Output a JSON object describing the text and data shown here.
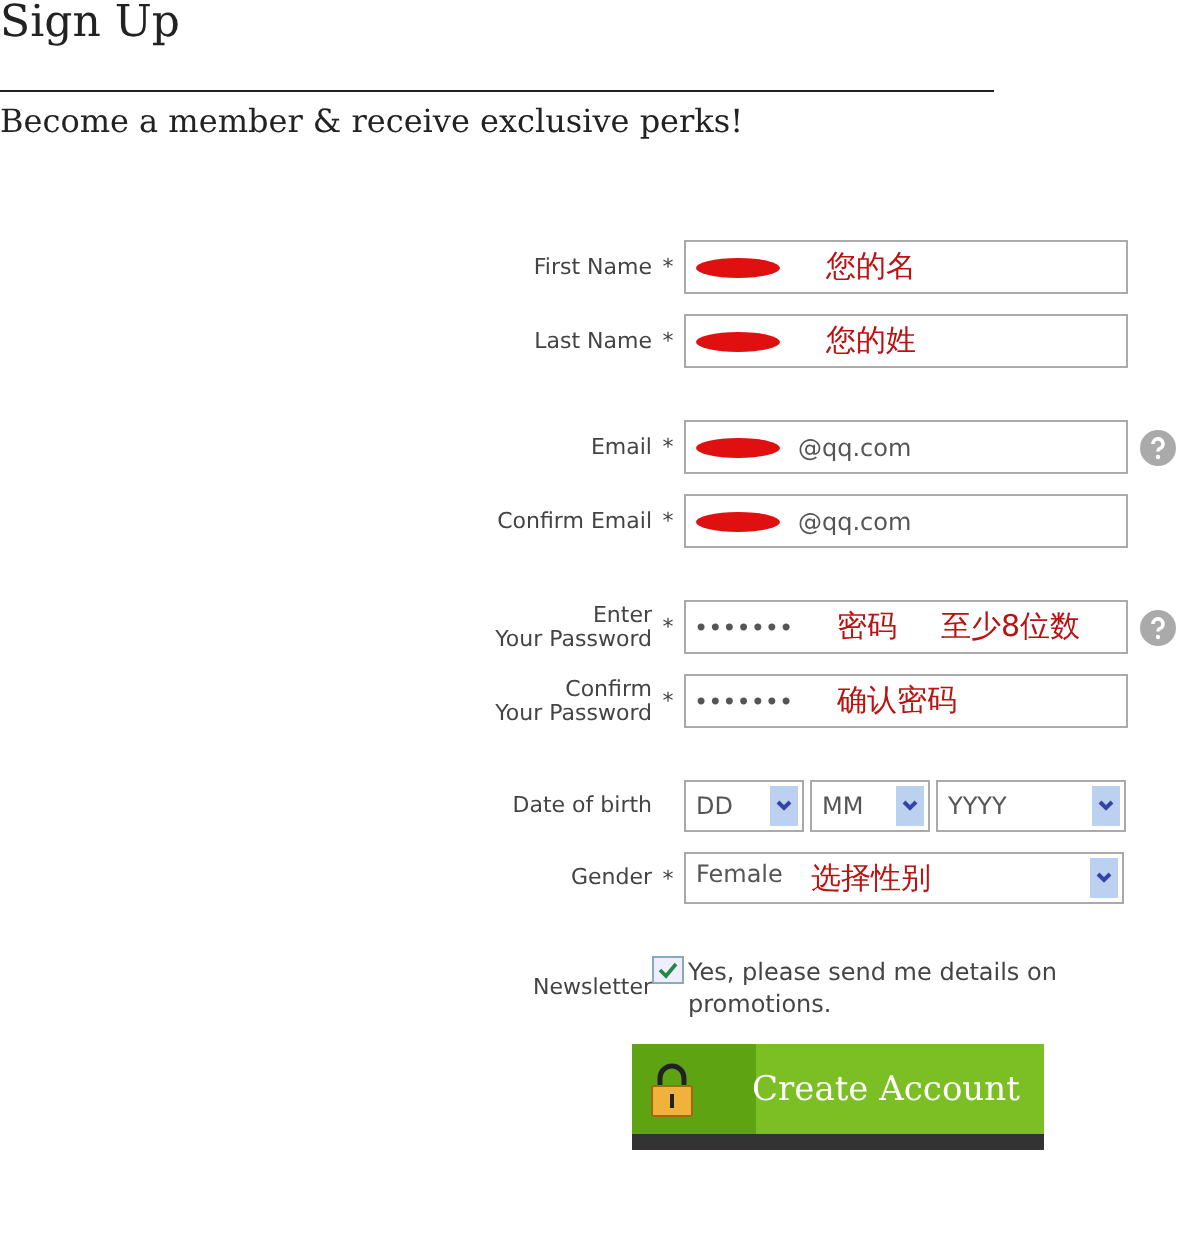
{
  "title": "Sign Up",
  "subtitle": "Become a member & receive exclusive perks!",
  "groups": [
    [
      {
        "kind": "text",
        "label": [
          "First Name"
        ],
        "asterisk": "*",
        "redacted": true,
        "notes": [
          "您的名"
        ]
      },
      {
        "kind": "text",
        "label": [
          "Last Name"
        ],
        "asterisk": "*",
        "redacted": true,
        "notes": [
          "您的姓"
        ]
      }
    ],
    [
      {
        "kind": "text",
        "label": [
          "Email"
        ],
        "asterisk": "*",
        "redacted": true,
        "value": "@qq.com",
        "help": true
      },
      {
        "kind": "text",
        "label": [
          "Confirm Email"
        ],
        "asterisk": "*",
        "redacted": true,
        "value": "@qq.com"
      }
    ],
    [
      {
        "kind": "password",
        "label": [
          "Enter",
          "Your Password"
        ],
        "asterisk": "*",
        "value": "•••••••",
        "notes": [
          "密码",
          "至少8位数"
        ],
        "help": true
      },
      {
        "kind": "password",
        "label": [
          "Confirm",
          "Your Password"
        ],
        "asterisk": "*",
        "value": "•••••••",
        "notes": [
          "确认密码"
        ]
      }
    ],
    [
      {
        "kind": "date",
        "label": [
          "Date of birth"
        ],
        "selects": [
          "DD",
          "MM",
          "YYYY"
        ]
      },
      {
        "kind": "select",
        "label": [
          "Gender"
        ],
        "asterisk": "*",
        "value": "Female",
        "notes": [
          "选择性别"
        ]
      }
    ],
    [
      {
        "kind": "checkbox",
        "label": [
          "Newsletter"
        ],
        "checked": true,
        "text": "Yes, please send me details on promotions."
      }
    ]
  ],
  "button": "Create Account"
}
